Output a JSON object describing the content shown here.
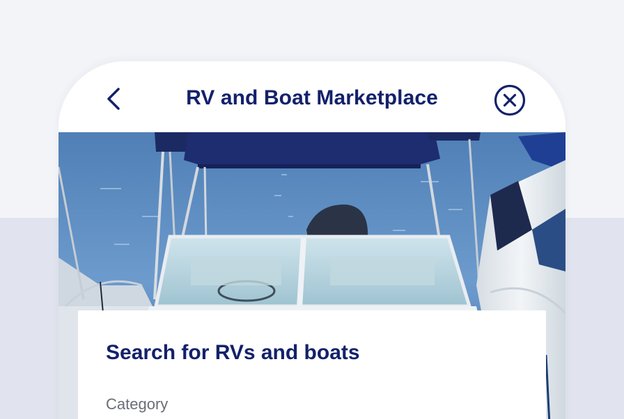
{
  "header": {
    "title": "RV and Boat Marketplace",
    "back_icon": "chevron-left-icon",
    "close_icon": "close-circle-icon"
  },
  "hero": {
    "image": "boat-photo"
  },
  "search_card": {
    "title": "Search for RVs and boats",
    "category_label": "Category"
  },
  "colors": {
    "brand": "#13216b",
    "page_bg": "#f3f4f8",
    "page_bg_lower": "#e1e4ee",
    "label_gray": "#6a6d78"
  }
}
